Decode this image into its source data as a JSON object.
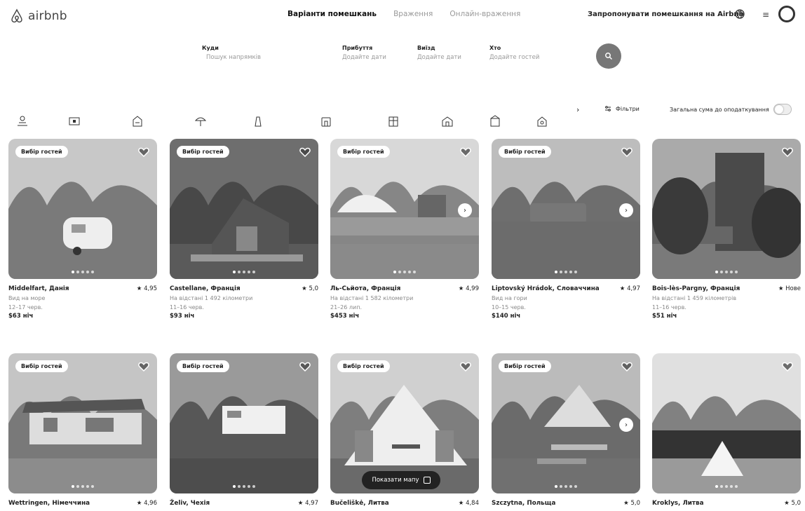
{
  "header": {
    "logo_text": "airbnb",
    "tabs": [
      {
        "label": "Варіанти помешкань",
        "active": true
      },
      {
        "label": "Враження",
        "active": false
      },
      {
        "label": "Онлайн-враження",
        "active": false
      }
    ],
    "host_link": "Запропонувати помешкання на Airbnb"
  },
  "search": {
    "where": {
      "label": "Куди",
      "placeholder": "Пошук напрямків"
    },
    "checkin": {
      "label": "Прибуття",
      "placeholder": "Додайте дати"
    },
    "checkout": {
      "label": "Виїзд",
      "placeholder": "Додайте дати"
    },
    "who": {
      "label": "Хто",
      "placeholder": "Додайте гостей"
    }
  },
  "filters": {
    "filters_label": "Фільтри",
    "tax_label": "Загальна сума до оподаткування"
  },
  "categories": [
    "pool-icon",
    "cabin-icon",
    "farm-icon",
    "beach-icon",
    "castle-icon",
    "tiny-home-icon",
    "countryside-icon",
    "mansion-icon",
    "camping-icon",
    "lake-icon"
  ],
  "badge_label": "Вибір гостей",
  "listings": [
    {
      "title": "Middelfart, Данія",
      "rating": "★ 4,95",
      "line1": "Вид на море",
      "line2": "12–17 черв.",
      "price": "$63 ніч",
      "badge": true
    },
    {
      "title": "Castellane, Франція",
      "rating": "★ 5,0",
      "line1": "На відстані 1 492 кілометри",
      "line2": "11–16 черв.",
      "price": "$93 ніч",
      "badge": true
    },
    {
      "title": "Ль-Сьйота, Франція",
      "rating": "★ 4,99",
      "line1": "На відстані 1 582 кілометри",
      "line2": "21–26 лип.",
      "price": "$453 ніч",
      "badge": true
    },
    {
      "title": "Liptovský Hrádok, Словаччина",
      "rating": "★ 4,97",
      "line1": "Вид на гори",
      "line2": "10–15 черв.",
      "price": "$140 ніч",
      "badge": true
    },
    {
      "title": "Bois-lès-Pargny, Франція",
      "rating": "★ Нове",
      "line1": "На відстані 1 459 кілометрів",
      "line2": "11–16 черв.",
      "price": "$51 ніч",
      "badge": false
    },
    {
      "title": "Wettringen, Німеччина",
      "rating": "★ 4,96",
      "badge": true
    },
    {
      "title": "Želiv, Чехія",
      "rating": "★ 4,97",
      "badge": true
    },
    {
      "title": "Bučeliškė, Литва",
      "rating": "★ 4,84",
      "badge": true
    },
    {
      "title": "Szczytna, Польща",
      "rating": "★ 5,0",
      "badge": true
    },
    {
      "title": "Kroklys, Литва",
      "rating": "★ 5,0",
      "badge": false
    }
  ],
  "map_button": "Показати мапу"
}
